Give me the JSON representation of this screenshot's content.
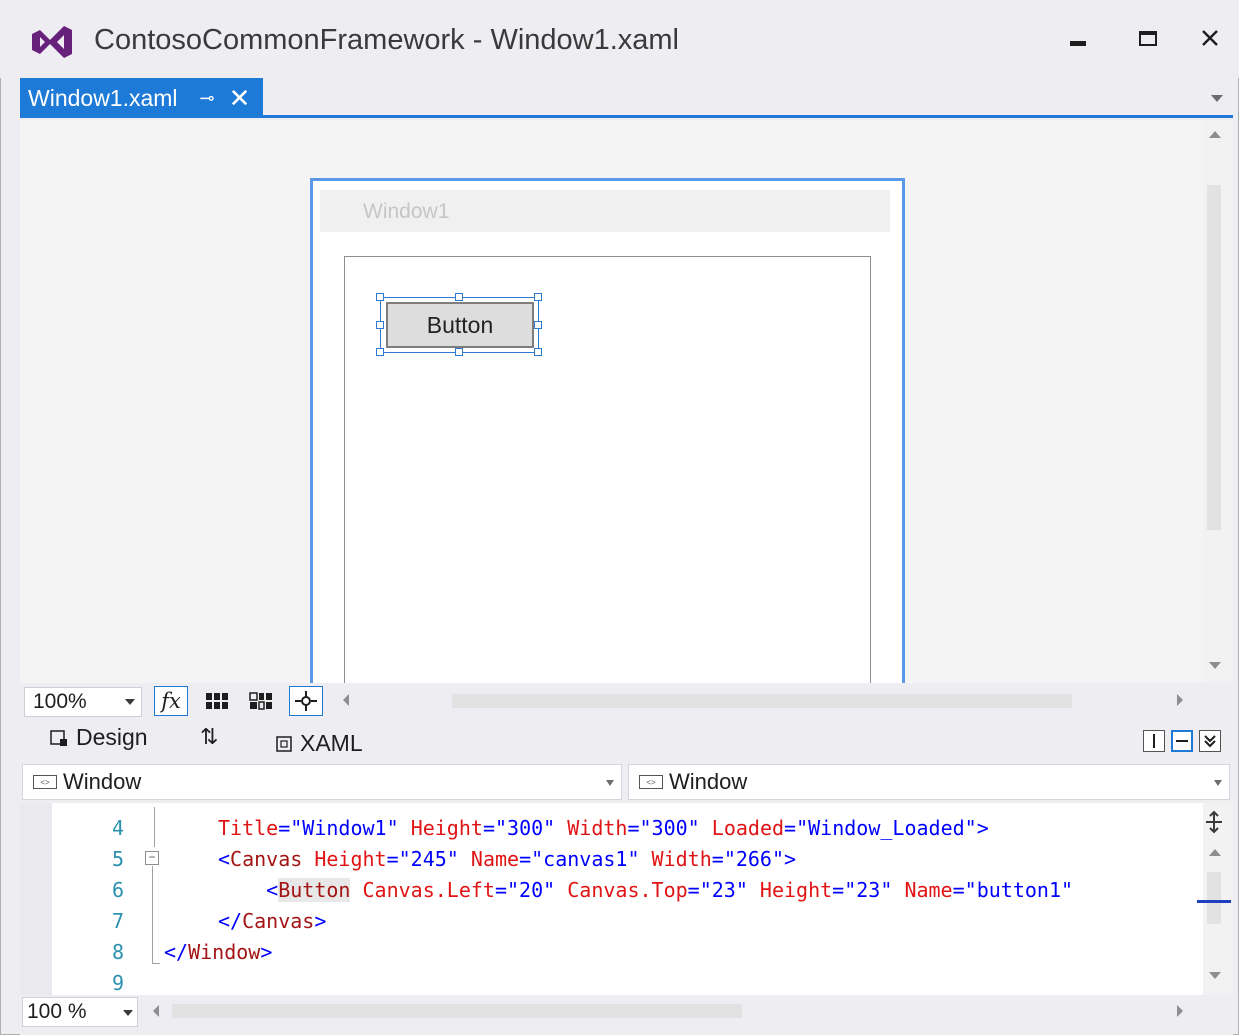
{
  "window": {
    "title": "ContosoCommonFramework - Window1.xaml",
    "app_icon": "visual-studio-logo",
    "controls": {
      "minimize_icon": "minimize-icon",
      "maximize_icon": "maximize-icon",
      "close_icon": "close-icon"
    }
  },
  "tab": {
    "label": "Window1.xaml",
    "pin_glyph": "⊸",
    "close_glyph": "✕"
  },
  "designer": {
    "window_title": "Window1",
    "button_label": "Button"
  },
  "design_toolbar": {
    "zoom": "100%",
    "fx_label": "fx"
  },
  "split_tabs": {
    "design_label": "Design",
    "swap_glyph": "⇅",
    "xaml_label": "XAML"
  },
  "nav": {
    "left_scope": "Window",
    "right_scope": "Window"
  },
  "code": {
    "partial_top_visible": true,
    "lines": [
      {
        "num": "4"
      },
      {
        "num": "5"
      },
      {
        "num": "6"
      },
      {
        "num": "7"
      },
      {
        "num": "8"
      },
      {
        "num": "9"
      }
    ],
    "line4": {
      "a1": "Title",
      "v1": "\"Window1\"",
      "a2": "Height",
      "v2": "\"300\"",
      "a3": "Width",
      "v3": "\"300\"",
      "a4": "Loaded",
      "v4": "\"Window_Loaded\"",
      "end": ">"
    },
    "line5": {
      "tag": "Canvas",
      "a1": "Height",
      "v1": "\"245\"",
      "a2": "Name",
      "v2": "\"canvas1\"",
      "a3": "Width",
      "v3": "\"266\"",
      "end": ">"
    },
    "line6": {
      "tag": "Button",
      "a1": "Canvas.Left",
      "v1": "\"20\"",
      "a2": "Canvas.Top",
      "v2": "\"23\"",
      "a3": "Height",
      "v3": "\"23\"",
      "a4": "Name",
      "v4": "\"button1\""
    },
    "line7": {
      "text": "Canvas"
    },
    "line8": {
      "text": "Window"
    }
  },
  "editor_toolbar": {
    "zoom": "100 %"
  },
  "colors": {
    "accent": "#1e7ad7",
    "vs_purple": "#68217a",
    "attr_red": "#e01414",
    "value_blue": "#0000ff",
    "tag_maroon": "#a31515",
    "line_number": "#2b91af"
  }
}
